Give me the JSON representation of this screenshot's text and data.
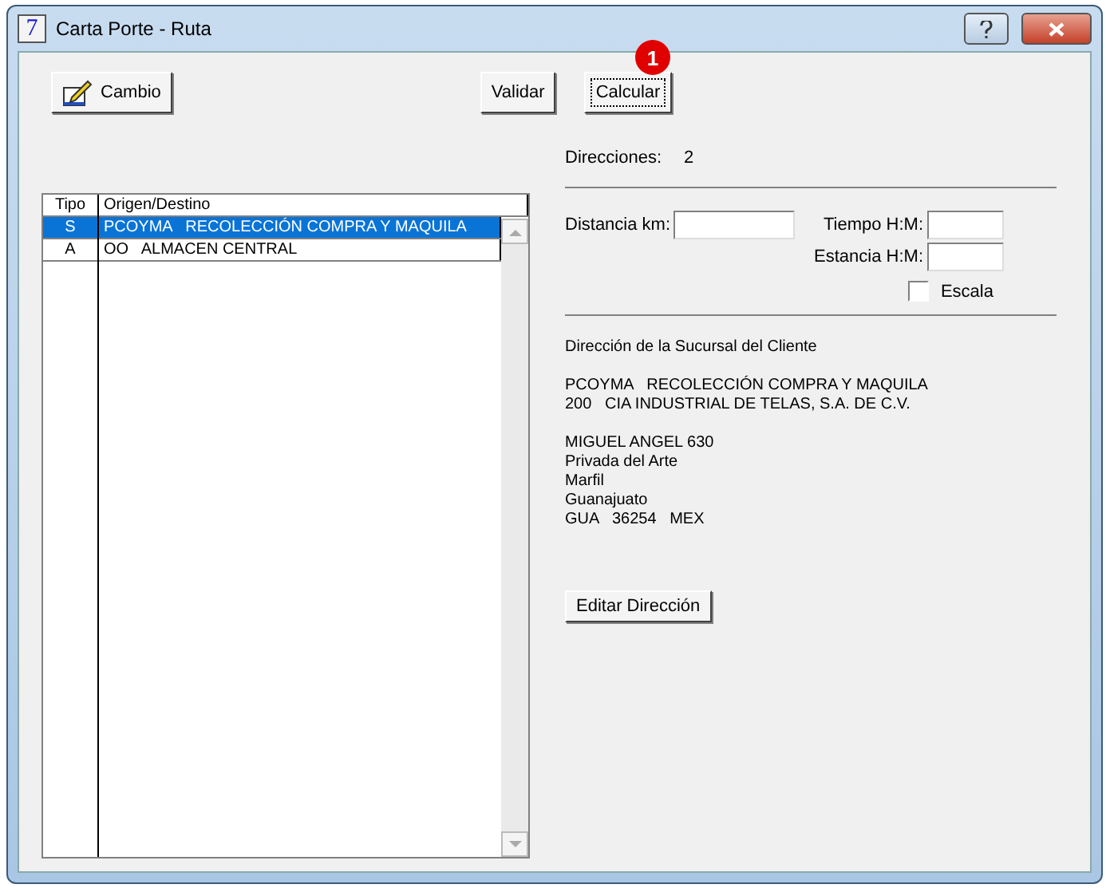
{
  "window": {
    "title": "Carta Porte - Ruta",
    "app_icon": "7"
  },
  "toolbar": {
    "change_button": "Cambio",
    "validate_button": "Validar",
    "calculate_button": "Calcular",
    "badge": "1"
  },
  "table": {
    "columns": [
      "Tipo",
      "Origen/Destino"
    ],
    "rows": [
      {
        "tipo": "S",
        "origen_destino": "PCOYMA   RECOLECCIÓN COMPRA Y MAQUILA",
        "selected": true
      },
      {
        "tipo": "A",
        "origen_destino": "OO   ALMACEN CENTRAL",
        "selected": false
      }
    ]
  },
  "directions": {
    "label": "Direcciones:",
    "value": "2"
  },
  "fields": {
    "distance_label": "Distancia km:",
    "time_label": "Tiempo H:M:",
    "stay_label": "Estancia H:M:"
  },
  "escala": {
    "label": "Escala",
    "checked": false
  },
  "address": {
    "heading": "Dirección de la Sucursal del Cliente",
    "blocks": [
      [
        "PCOYMA   RECOLECCIÓN COMPRA Y MAQUILA",
        "200   CIA INDUSTRIAL DE TELAS, S.A. DE C.V."
      ],
      [
        "MIGUEL ANGEL 630",
        "Privada del Arte",
        "Marfil",
        "Guanajuato",
        "GUA   36254   MEX"
      ]
    ],
    "edit_button": "Editar Dirección"
  }
}
